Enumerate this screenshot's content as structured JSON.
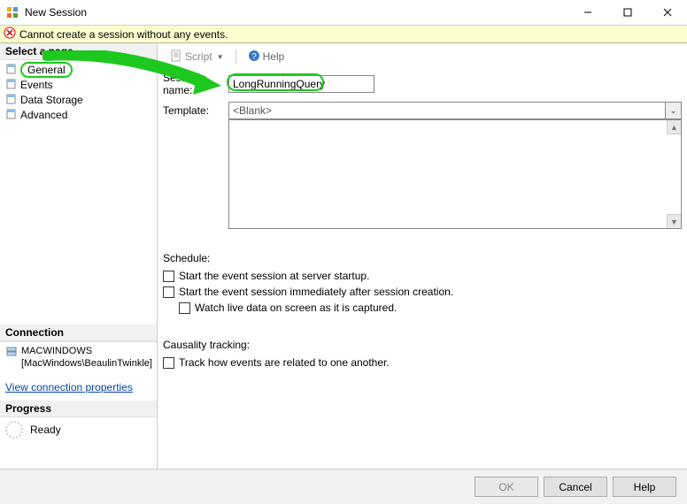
{
  "window": {
    "title": "New Session"
  },
  "error": {
    "text": "Cannot create a session without any events."
  },
  "sidebar": {
    "select_page_header": "Select a page",
    "items": [
      {
        "label": "General"
      },
      {
        "label": "Events"
      },
      {
        "label": "Data Storage"
      },
      {
        "label": "Advanced"
      }
    ],
    "connection_header": "Connection",
    "server": "MACWINDOWS",
    "user": "[MacWindows\\BeaulinTwinkle]",
    "view_conn_props": "View connection properties",
    "progress_header": "Progress",
    "progress_text": "Ready"
  },
  "toolbar": {
    "script": "Script",
    "help": "Help"
  },
  "form": {
    "session_name_label": "Session name:",
    "session_name_value": "LongRunningQuery",
    "template_label": "Template:",
    "template_value": "<Blank>",
    "schedule_label": "Schedule:",
    "schedule_opts": [
      "Start the event session at server startup.",
      "Start the event session immediately after session creation.",
      "Watch live data on screen as it is captured."
    ],
    "causality_label": "Causality tracking:",
    "causality_opt": "Track how events are related to one another."
  },
  "buttons": {
    "ok": "OK",
    "cancel": "Cancel",
    "help": "Help"
  }
}
